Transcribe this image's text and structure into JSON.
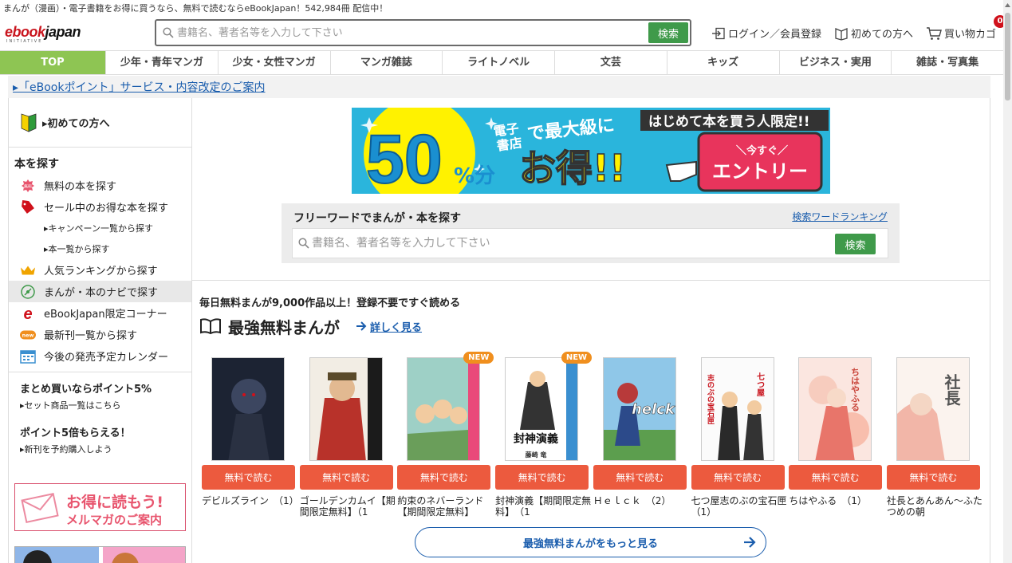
{
  "tagline": "まんが（漫画）・電子書籍をお得に買うなら、無料で読むならeBookJapan！542,984冊 配信中！",
  "logo": {
    "part1": "ebook",
    "part2": "japan",
    "sub": "INITIATIVE"
  },
  "search_top": {
    "placeholder": "書籍名、著者名等を入力して下さい",
    "button": "検索"
  },
  "header_links": {
    "login": "ログイン／会員登録",
    "beginner": "初めての方へ",
    "cart": "買い物カゴ",
    "cart_count": "0"
  },
  "nav": [
    "TOP",
    "少年・青年マンガ",
    "少女・女性マンガ",
    "マンガ雑誌",
    "ライトノベル",
    "文芸",
    "キッズ",
    "ビジネス・実用",
    "雑誌・写真集"
  ],
  "notice": "▸「eBookポイント」サービス・内容改定のご案内",
  "sidebar": {
    "first": "▸初めての方へ",
    "heading": "本を探す",
    "items": [
      {
        "label": "無料の本を探す",
        "icon": "free-icon"
      },
      {
        "label": "セール中のお得な本を探す",
        "icon": "sale-tag-icon"
      }
    ],
    "subs": [
      "▸キャンペーン一覧から探す",
      "▸本一覧から探す"
    ],
    "items2": [
      {
        "label": "人気ランキングから探す",
        "icon": "crown-icon"
      },
      {
        "label": "まんが・本のナビで探す",
        "icon": "navi-icon"
      },
      {
        "label": "eBookJapan限定コーナー",
        "icon": "ebookjapan-e-icon"
      },
      {
        "label": "最新刊一覧から探す",
        "icon": "new-badge-icon"
      },
      {
        "label": "今後の発売予定カレンダー",
        "icon": "calendar-icon"
      }
    ],
    "promo1_title": "まとめ買いならポイント5%",
    "promo1_sub": "▸セット商品一覧はこちら",
    "promo2_title": "ポイント5倍もらえる！",
    "promo2_sub": "▸新刊を予約購入しよう",
    "mail_title": "お得に読もう!",
    "mail_sub": "メルマガのご案内"
  },
  "promo_banner": {
    "big": "50",
    "unit": "%分",
    "line1a": "電子",
    "line1b": "書店",
    "line2": "で最大級に",
    "otoku": "お得!!",
    "ribbon": "はじめて本を買う人限定!!",
    "cta_small": "＼今すぐ／",
    "cta": "エントリー"
  },
  "search_panel": {
    "title": "フリーワードでまんが・本を探す",
    "ranking_link": "検索ワードランキング",
    "placeholder": "書籍名、著者名等を入力して下さい",
    "button": "検索"
  },
  "daily_text": "毎日無料まんが9,000作品以上！登録不要ですぐ読める",
  "section_title": "最強無料まんが",
  "more_details": "詳しく見る",
  "free_button": "無料で読む",
  "new_label": "NEW",
  "books": [
    {
      "title": "デビルズライン　（1）",
      "new": false,
      "cover": "devilsline"
    },
    {
      "title": "ゴールデンカムイ【期間限定無料】（1",
      "new": false,
      "cover": "kamuy"
    },
    {
      "title": "約束のネバーランド【期間限定無料】",
      "new": true,
      "cover": "neverland"
    },
    {
      "title": "封神演義【期間限定無料】　（1",
      "new": true,
      "cover": "houshin"
    },
    {
      "title": "Ｈｅｌｃｋ　（2）",
      "new": false,
      "cover": "helck"
    },
    {
      "title": "七つ屋志のぶの宝石匣　（1）",
      "new": false,
      "cover": "nanatsuya"
    },
    {
      "title": "ちはやふる　（1）",
      "new": false,
      "cover": "chihaya"
    },
    {
      "title": "社長とあんあん～ふたつめの朝",
      "new": false,
      "cover": "shacho"
    }
  ],
  "cover_text": {
    "helck": "helck",
    "houshin": "封神演義",
    "houshin_author": "藤崎 竜",
    "nanatsuya": "七つ屋",
    "nanatsuya2": "志のぶの宝石匣",
    "chihaya": "ちはやふる",
    "shacho": "社長"
  },
  "more_button": "最強無料まんがをもっと見る",
  "colors": {
    "green": "#3f9a4a",
    "nav_active": "#8ec553",
    "free_btn": "#ec5a3e",
    "link": "#1a5dad",
    "brand_red": "#c9151e"
  }
}
